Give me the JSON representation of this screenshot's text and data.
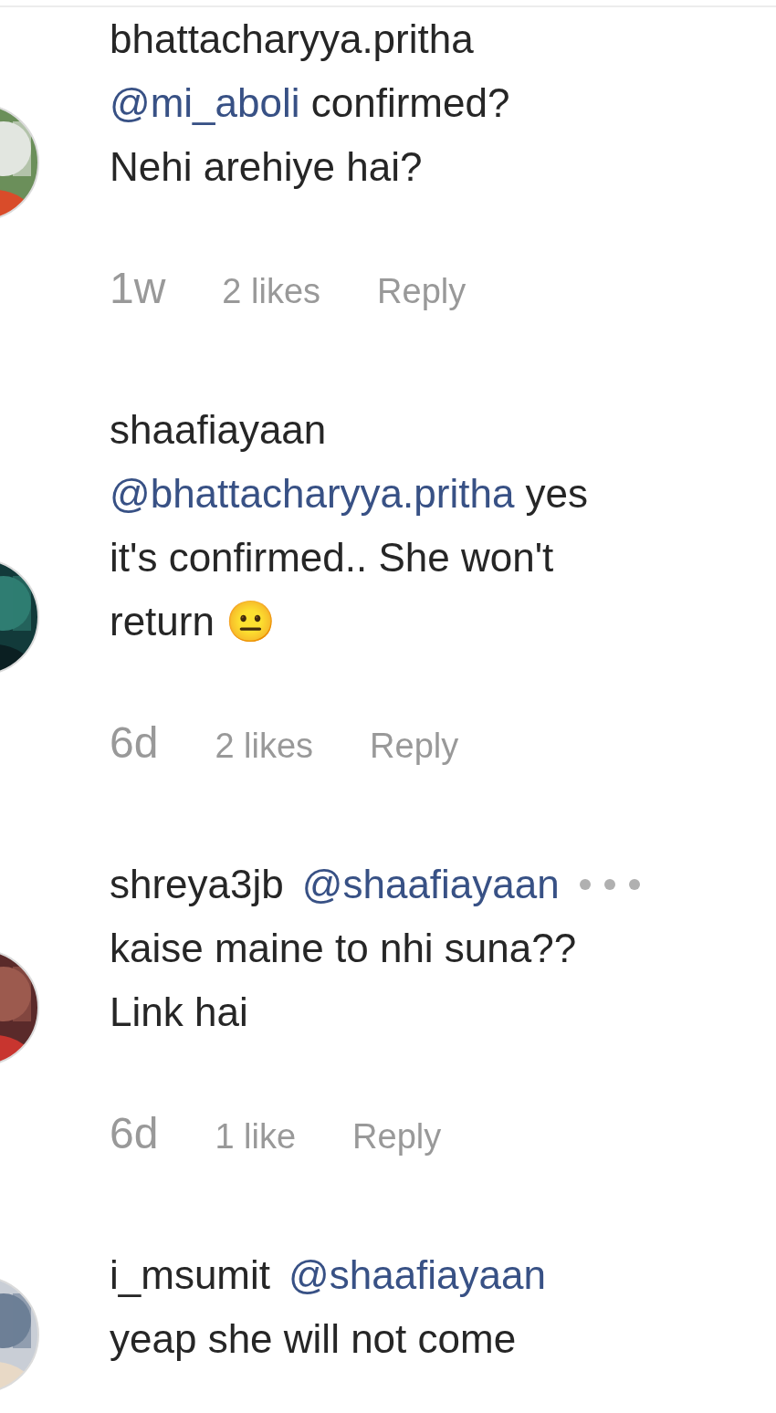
{
  "comments": [
    {
      "username": "bhattacharyya.pritha",
      "more": false,
      "lines": [
        [
          {
            "kind": "mention",
            "text": "@mi_aboli"
          },
          {
            "kind": "text",
            "text": " confirmed?"
          }
        ],
        [
          {
            "kind": "text",
            "text": "Nehi arehiye hai?"
          }
        ]
      ],
      "time": "1w",
      "likes": "2 likes",
      "reply": "Reply"
    },
    {
      "username": "shaafiayaan",
      "more": false,
      "lines": [
        [
          {
            "kind": "mention",
            "text": "@bhattacharyya.pritha"
          },
          {
            "kind": "text",
            "text": " yes"
          }
        ],
        [
          {
            "kind": "text",
            "text": "it's confirmed.. She won't"
          }
        ],
        [
          {
            "kind": "text",
            "text": "return 😐"
          }
        ]
      ],
      "time": "6d",
      "likes": "2 likes",
      "reply": "Reply"
    },
    {
      "username": "shreya3jb",
      "more": true,
      "lines": [
        [
          {
            "kind": "mention",
            "text": "@shaafiayaan"
          }
        ],
        [
          {
            "kind": "text",
            "text": "kaise maine to nhi suna??"
          }
        ],
        [
          {
            "kind": "text",
            "text": "Link hai"
          }
        ]
      ],
      "time": "6d",
      "likes": "1 like",
      "reply": "Reply"
    },
    {
      "username": "i_msumit",
      "more": false,
      "lines": [
        [
          {
            "kind": "mention",
            "text": "@shaafiayaan"
          }
        ],
        [
          {
            "kind": "text",
            "text": "yeap she will not come"
          }
        ]
      ]
    }
  ]
}
